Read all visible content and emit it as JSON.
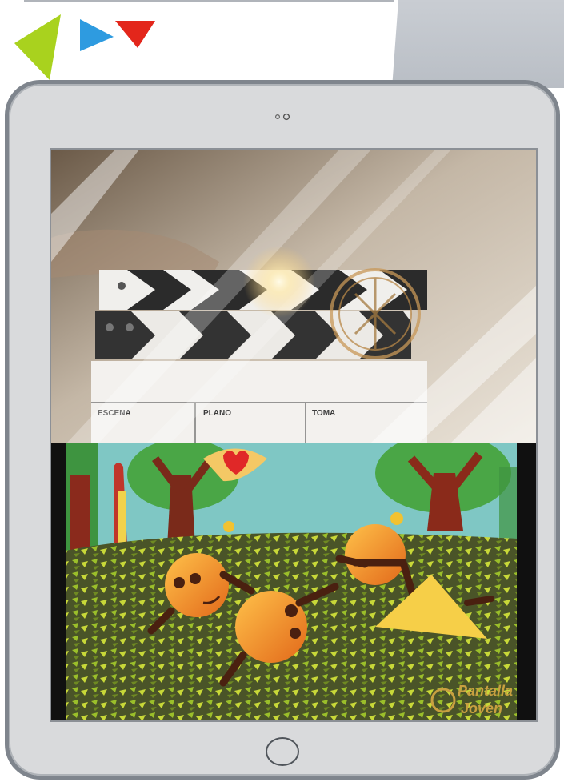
{
  "slate": {
    "col1": "ESCENA",
    "col2": "PLANO",
    "col3": "TOMA"
  },
  "watermark": {
    "line1": "Pantalla",
    "line2": "Joven"
  },
  "colors": {
    "logo_green": "#a9d21e",
    "logo_blue": "#2e9be0",
    "logo_red": "#e3261b",
    "tablet_frame": "#d9dadc",
    "tablet_border": "#7f858d"
  },
  "icons": {
    "logo": "triangles-logo-icon",
    "camera": "camera-icon",
    "home": "home-button-icon"
  }
}
